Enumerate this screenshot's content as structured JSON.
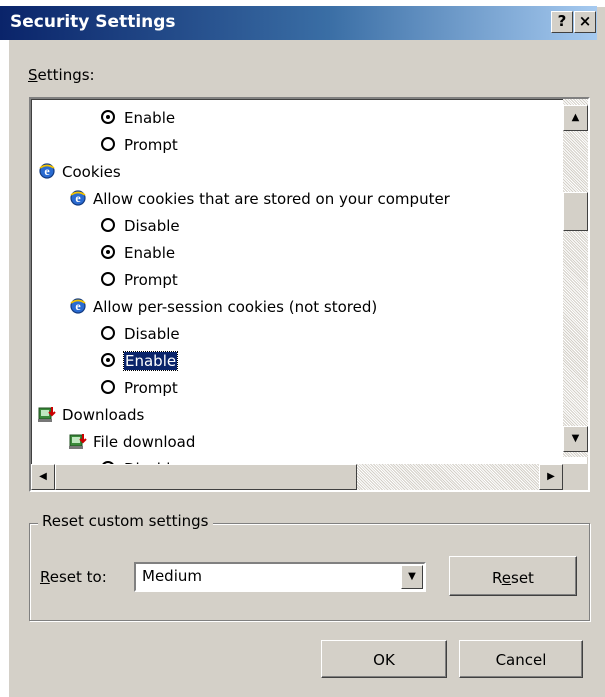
{
  "window": {
    "title": "Security Settings",
    "help_label": "?",
    "close_label": "×"
  },
  "settings_label": {
    "accel": "S",
    "rest": "ettings:"
  },
  "tree": [
    {
      "type": "radio",
      "label": "Enable",
      "checked": true,
      "indent": 2
    },
    {
      "type": "radio",
      "label": "Prompt",
      "checked": false,
      "indent": 2
    },
    {
      "type": "category",
      "label": "Cookies",
      "icon": "ie-icon",
      "indent": 0
    },
    {
      "type": "setting",
      "label": "Allow cookies that are stored on your computer",
      "icon": "ie-icon",
      "indent": 1
    },
    {
      "type": "radio",
      "label": "Disable",
      "checked": false,
      "indent": 2
    },
    {
      "type": "radio",
      "label": "Enable",
      "checked": true,
      "indent": 2
    },
    {
      "type": "radio",
      "label": "Prompt",
      "checked": false,
      "indent": 2
    },
    {
      "type": "setting",
      "label": "Allow per-session cookies (not stored)",
      "icon": "ie-icon",
      "indent": 1
    },
    {
      "type": "radio",
      "label": "Disable",
      "checked": false,
      "indent": 2
    },
    {
      "type": "radio",
      "label": "Enable",
      "checked": true,
      "selected": true,
      "indent": 2
    },
    {
      "type": "radio",
      "label": "Prompt",
      "checked": false,
      "indent": 2
    },
    {
      "type": "category",
      "label": "Downloads",
      "icon": "download-icon",
      "indent": 0
    },
    {
      "type": "setting",
      "label": "File download",
      "icon": "download-icon",
      "indent": 1
    },
    {
      "type": "radio",
      "label": "Disable",
      "checked": false,
      "indent": 2
    }
  ],
  "reset_group": {
    "legend": "Reset custom settings",
    "reset_to": {
      "accel": "R",
      "rest": "eset to:"
    },
    "combo_value": "Medium",
    "reset_button": {
      "pre": "R",
      "accel": "e",
      "post": "set"
    }
  },
  "ok_label": "OK",
  "cancel_label": "Cancel",
  "colors": {
    "title_start": "#0a246a",
    "title_end": "#a6caf0",
    "face": "#d4d0c8",
    "selection": "#0a246a"
  }
}
